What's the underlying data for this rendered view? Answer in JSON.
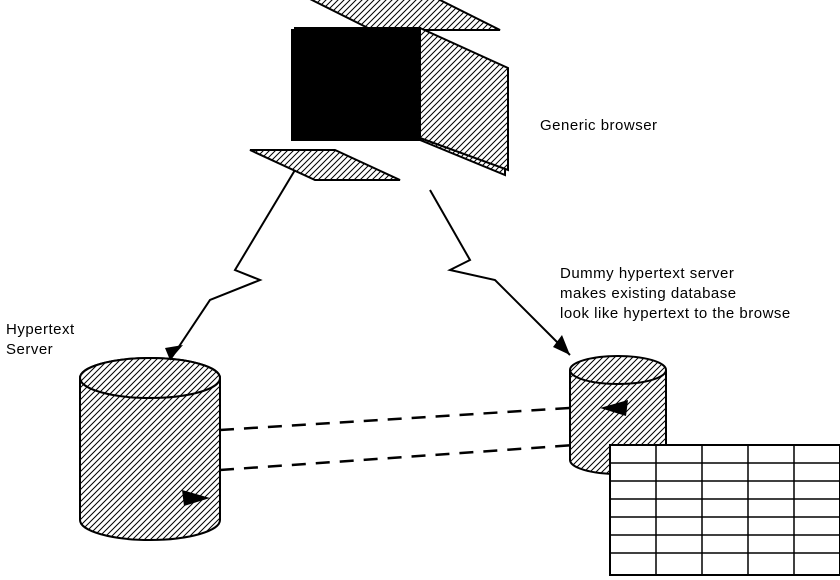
{
  "labels": {
    "browser": "Generic browser",
    "hypertext_server_line1": "Hypertext",
    "hypertext_server_line2": "Server",
    "dummy_line1": "Dummy hypertext server",
    "dummy_line2": "makes existing database",
    "dummy_line3": "look like hypertext to the browse"
  },
  "nodes": {
    "browser": "generic-browser",
    "hypertext_server": "hypertext-server-cylinder",
    "dummy_server": "dummy-server-cylinder",
    "database_grid": "database-grid"
  }
}
